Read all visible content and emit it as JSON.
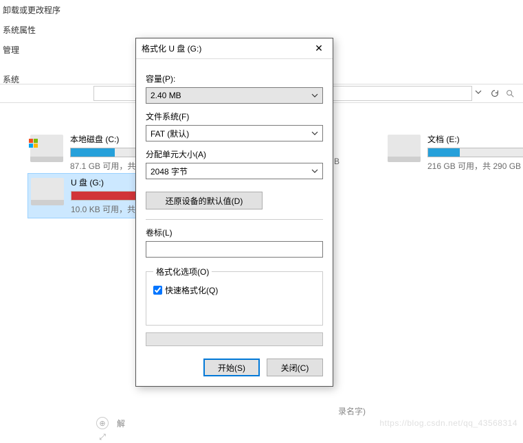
{
  "sidebar": {
    "items": [
      {
        "label": "卸载或更改程序"
      },
      {
        "label": "系统属性"
      },
      {
        "label": "管理"
      },
      {
        "label": "系统"
      }
    ]
  },
  "drives": {
    "c": {
      "name": "本地磁盘 (C:)",
      "stats": "87.1 GB 可用，共",
      "fill_pct": 36,
      "color": "#26a0da"
    },
    "g": {
      "name": "U 盘 (G:)",
      "stats": "10.0 KB 可用，共",
      "fill_pct": 98,
      "color": "#d13438"
    },
    "e": {
      "name": "文档 (E:)",
      "stats": "216 GB 可用，共 290 GB",
      "fill_pct": 26,
      "color": "#26a0da"
    }
  },
  "gb_stub": "B",
  "dialog": {
    "title": "格式化 U 盘 (G:)",
    "capacity_label": "容量(P):",
    "capacity_value": "2.40 MB",
    "fs_label": "文件系统(F)",
    "fs_value": "FAT (默认)",
    "alloc_label": "分配单元大小(A)",
    "alloc_value": "2048 字节",
    "restore_btn": "还原设备的默认值(D)",
    "volume_label": "卷标(L)",
    "volume_value": "",
    "format_options_label": "格式化选项(O)",
    "quick_format_label": "快速格式化(Q)",
    "start_btn": "开始(S)",
    "close_btn": "关闭(C)"
  },
  "ghost": {
    "text": "解",
    "text2": "录名字)"
  },
  "watermark": "https://blog.csdn.net/qq_43568314"
}
